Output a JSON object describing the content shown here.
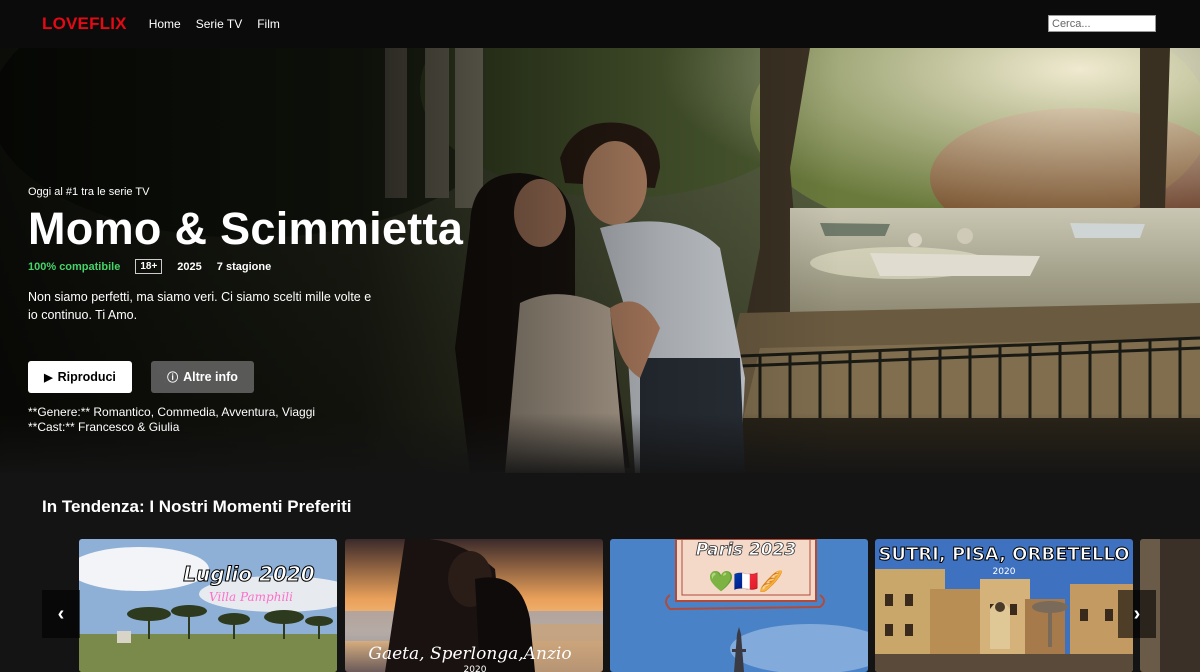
{
  "brand": {
    "logo": "LOVEFLIX",
    "accent": "#e50914"
  },
  "nav": {
    "items": [
      {
        "label": "Home"
      },
      {
        "label": "Serie TV"
      },
      {
        "label": "Film"
      }
    ],
    "search_placeholder": "Cerca..."
  },
  "hero": {
    "kicker": "Oggi al #1 tra le serie TV",
    "title": "Momo & Scimmietta",
    "match": "100% compatibile",
    "rating": "18+",
    "year": "2025",
    "seasons": "7 stagione",
    "description": "Non siamo perfetti, ma siamo veri. Ci siamo scelti mille volte e io continuo. Ti Amo.",
    "play_label": "Riproduci",
    "info_label": "Altre info",
    "genres": "**Genere:** Romantico, Commedia, Avventura, Viaggi",
    "cast": "**Cast:** Francesco & Giulia",
    "match_color": "#46d369"
  },
  "row": {
    "title": "In Tendenza: I Nostri Momenti Preferiti",
    "cards": [
      {
        "title": "Luglio 2020",
        "subtitle": "Villa Pamphili"
      },
      {
        "title": "Gaeta, Sperlonga,Anzio",
        "subtitle": "2020"
      },
      {
        "title": "Paris 2023",
        "emoji": "💚🇫🇷🥖"
      },
      {
        "title": "SUTRI, PISA, ORBETELLO",
        "subtitle": "2020"
      }
    ],
    "prev_icon": "‹",
    "next_icon": "›"
  }
}
